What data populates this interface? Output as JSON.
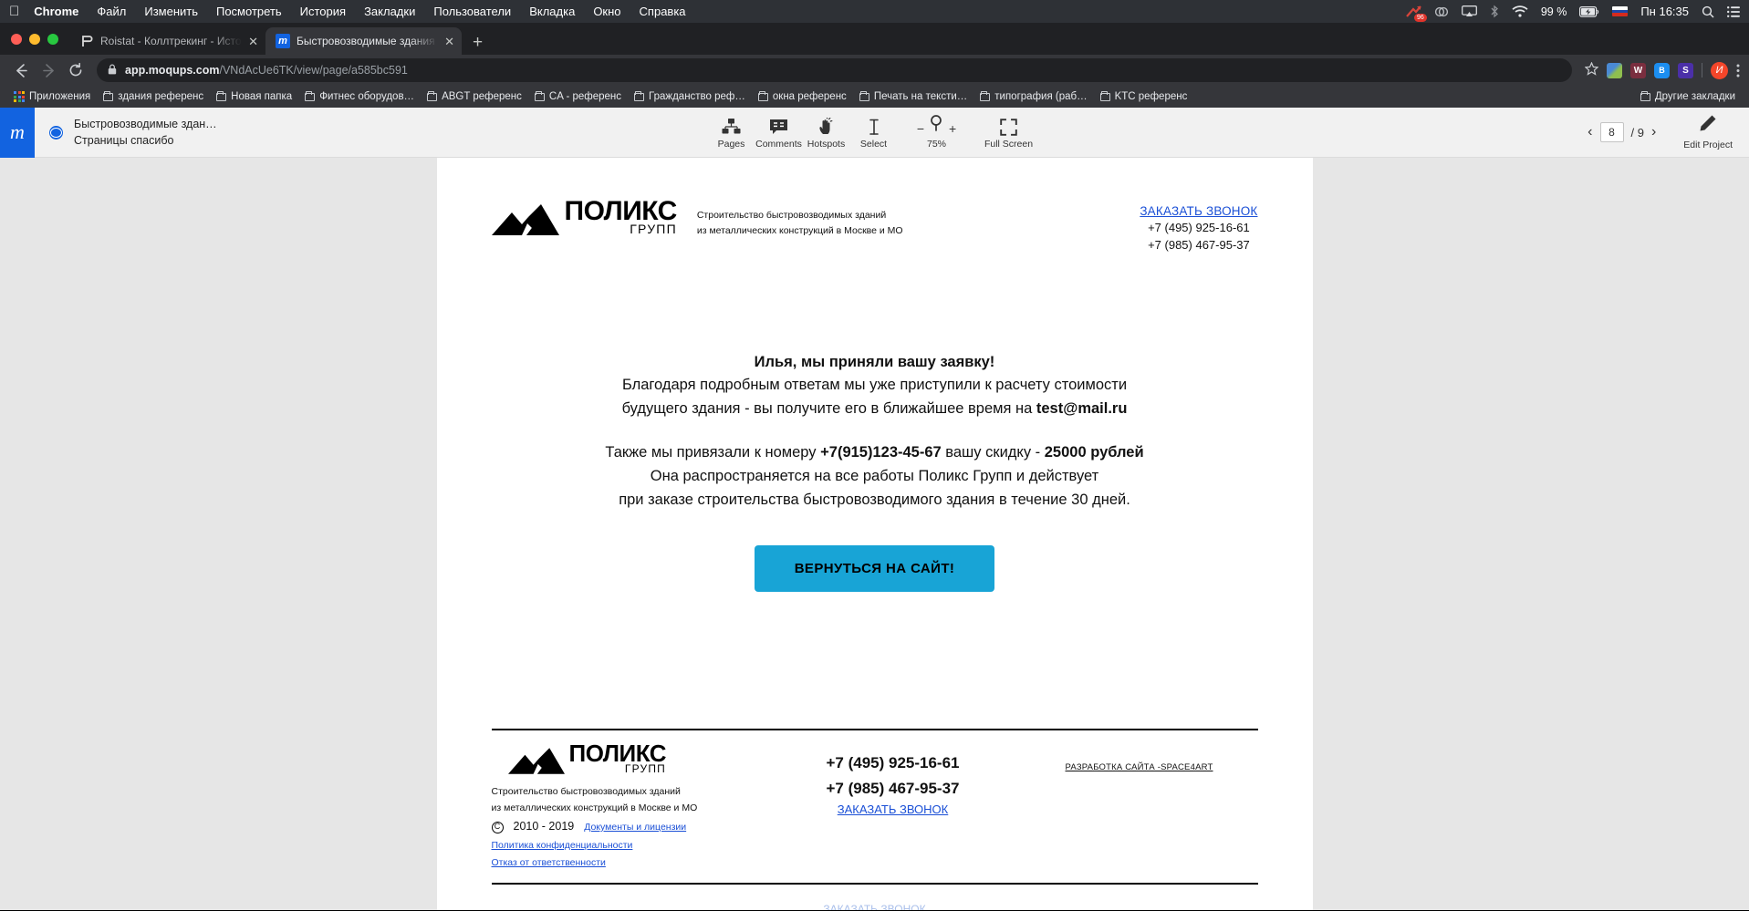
{
  "os_menubar": {
    "apple_icon": "apple-icon",
    "items": [
      {
        "label": "Chrome",
        "bold": true
      },
      {
        "label": "Файл",
        "bold": false
      },
      {
        "label": "Изменить",
        "bold": false
      },
      {
        "label": "Посмотреть",
        "bold": false
      },
      {
        "label": "История",
        "bold": false
      },
      {
        "label": "Закладки",
        "bold": false
      },
      {
        "label": "Пользователи",
        "bold": false
      },
      {
        "label": "Вкладка",
        "bold": false
      },
      {
        "label": "Окно",
        "bold": false
      },
      {
        "label": "Справка",
        "bold": false
      }
    ],
    "tray": {
      "notification_badge": "96",
      "battery_percent": "99 %",
      "language": "RU",
      "datetime": "Пн 16:35",
      "icons": [
        "roistat-icon",
        "creative-cloud-icon",
        "airplay-icon",
        "bluetooth-icon",
        "wifi-icon",
        "battery-charging-icon",
        "flag-icon",
        "spotlight-search-icon",
        "control-center-icon"
      ]
    }
  },
  "browser": {
    "tabs": [
      {
        "title": "Roistat - Коллтрекинг - Истор",
        "favicon": "roistat-favicon",
        "active": false
      },
      {
        "title": "Быстровозводимые здания (П",
        "favicon": "moqups-favicon",
        "active": true
      }
    ],
    "new_tab_label": "+",
    "close_label": "✕",
    "omnibox": {
      "lock_icon": "lock-icon",
      "host": "app.moqups.com",
      "path": "/VNdAcUe6TK/view/page/a585bc591"
    },
    "nav": {
      "back": "‹",
      "forward": "›",
      "reload": "⟳"
    },
    "extensions": [
      "photoshop-ext-icon",
      "w-ext-icon",
      "bitly-ext-icon",
      "s-ext-icon"
    ],
    "profile_initial": "И",
    "menu_icon": "kebab-menu-icon",
    "bookmark_star": "star-icon",
    "bookmarks": [
      {
        "label": "Приложения",
        "icon": "apps-grid-icon"
      },
      {
        "label": "здания референс",
        "icon": "folder-icon"
      },
      {
        "label": "Новая папка",
        "icon": "folder-icon"
      },
      {
        "label": "Фитнес оборудов…",
        "icon": "folder-icon"
      },
      {
        "label": "ABGT референс",
        "icon": "folder-icon"
      },
      {
        "label": "CA - референс",
        "icon": "folder-icon"
      },
      {
        "label": "Гражданство реф…",
        "icon": "folder-icon"
      },
      {
        "label": "окна референс",
        "icon": "folder-icon"
      },
      {
        "label": "Печать на тексти…",
        "icon": "folder-icon"
      },
      {
        "label": "типография (раб…",
        "icon": "folder-icon"
      },
      {
        "label": "KTC референс",
        "icon": "folder-icon"
      }
    ],
    "other_bookmarks": "Другие закладки"
  },
  "moqups": {
    "logo": "m",
    "project_title": "Быстровозводимые здан…",
    "page_name": "Страницы спасибо",
    "globe_icon": "globe-icon",
    "tools": [
      {
        "label": "Pages",
        "icon": "pages-icon"
      },
      {
        "label": "Comments",
        "icon": "comments-icon"
      },
      {
        "label": "Hotspots",
        "icon": "hotspots-hand-icon"
      },
      {
        "label": "Select",
        "icon": "select-cursor-icon"
      }
    ],
    "zoom": {
      "minus": "−",
      "plus": "+",
      "level": "75%",
      "icon": "magnifier-icon"
    },
    "fullscreen": {
      "label": "Full Screen",
      "icon": "fullscreen-icon"
    },
    "pager": {
      "prev": "‹",
      "next": "›",
      "current": "8",
      "total": "/ 9"
    },
    "edit_project": {
      "label": "Edit Project",
      "icon": "pencil-icon"
    }
  },
  "page": {
    "header": {
      "brand_main": "ПОЛИКС",
      "brand_sub": "ГРУПП",
      "logo_icon": "mountain-logo-icon",
      "tagline_line1": "Строительство быстровозводимых зданий",
      "tagline_line2": "из металлических конструкций в Москве и МО",
      "call_link": "ЗАКАЗАТЬ ЗВОНОК",
      "phone1": "+7 (495) 925-16-61",
      "phone2": "+7 (985) 467-95-37"
    },
    "message": {
      "heading": "Илья, мы приняли вашу заявку!",
      "line1": "Благодаря подробным ответам мы уже приступили к расчету стоимости",
      "line2_a": "будущего здания - вы получите его в ближайшее время на ",
      "line2_b": "test@mail.ru",
      "line3_a": "Также мы привязали к номеру ",
      "line3_b": "+7(915)123-45-67",
      "line3_c": " вашу скидку - ",
      "line3_d": "25000 рублей",
      "line4": "Она распространяется на все работы Поликс Групп и действует",
      "line5": "при заказе строительства быстровозводимого здания в течение 30 дней."
    },
    "cta_button": "ВЕРНУТЬСЯ НА САЙТ!",
    "footer": {
      "brand_main": "ПОЛИКС",
      "brand_sub": "ГРУПП",
      "logo_icon": "mountain-logo-icon",
      "tagline_line1": "Строительство быстровозводимых зданий",
      "tagline_line2": "из металлических конструкций в Москве и МО",
      "copyright_icon": "copyright-icon",
      "years": "2010 - 2019",
      "docs_link": "Документы и лицензии",
      "privacy_link": "Политика конфиденциальности",
      "disclaimer_link": "Отказ от ответственности",
      "phone1": "+7 (495) 925-16-61",
      "phone2": "+7 (985) 467-95-37",
      "call_link": "ЗАКАЗАТЬ ЗВОНОК",
      "dev_credit": "РАЗРАБОТКА САЙТА -SPACE4ART",
      "below_fold_hint": "ЗАКАЗАТЬ ЗВОНОК"
    }
  },
  "colors": {
    "accent_blue": "#1a4fd6",
    "cta_cyan": "#18a4d6",
    "moqups_blue": "#1263e0",
    "chrome_dark": "#35363a"
  }
}
